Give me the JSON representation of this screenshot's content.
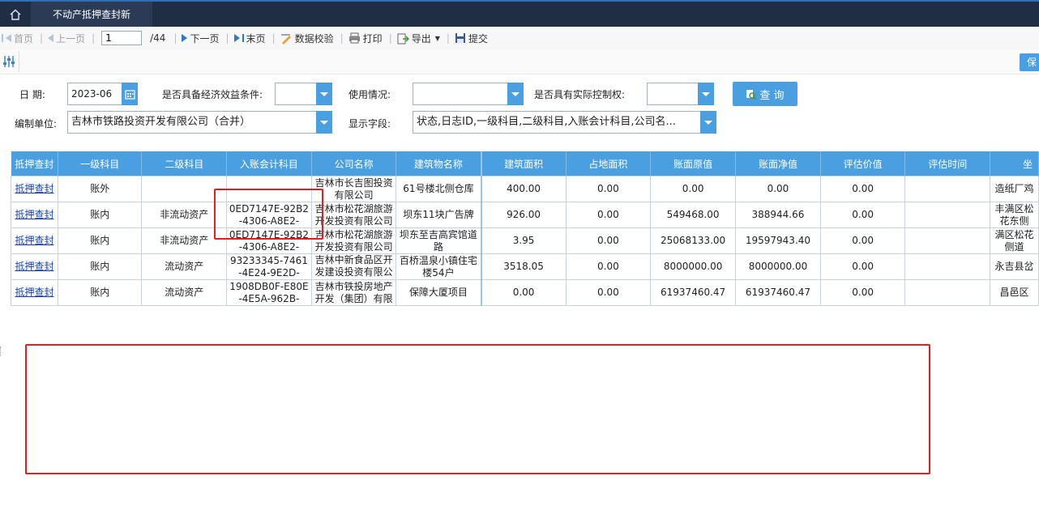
{
  "app": {
    "tab_title": "不动产抵押查封新"
  },
  "toolbar": {
    "first": "首页",
    "prev": "上一页",
    "page_value": "1",
    "page_total": "/44",
    "next": "下一页",
    "last": "末页",
    "validate": "数据校验",
    "print": "打印",
    "export": "导出",
    "submit": "提交"
  },
  "strip": {
    "save_label": "保"
  },
  "filters": {
    "date_label": "日  期:",
    "date_value": "2023-06",
    "econ_label": "是否具备经济效益条件:",
    "econ_value": "",
    "usage_label": "使用情况:",
    "usage_value": "",
    "control_label": "是否具有实际控制权:",
    "control_value": "",
    "query_label": "查 询",
    "unit_label": "编制单位:",
    "unit_value": "吉林市铁路投资开发有限公司（合并）",
    "fields_label": "显示字段:",
    "fields_value": "状态,日志ID,一级科目,二级科目,入账会计科目,公司名..."
  },
  "table": {
    "headers": [
      "抵押查封",
      "一级科目",
      "二级科目",
      "入账会计科目",
      "公司名称",
      "建筑物名称",
      "建筑面积",
      "占地面积",
      "账面原值",
      "账面净值",
      "评估价值",
      "评估时间",
      "坐"
    ],
    "rows": [
      {
        "action": "抵押查封",
        "level1": "账外",
        "level2": "",
        "account": "",
        "company": "吉林市长吉图投资有限公司",
        "building": "61号楼北侧仓库",
        "area": "400.00",
        "land": "0.00",
        "orig": "0.00",
        "net": "0.00",
        "eval": "0.00",
        "evaltime": "",
        "loc": "造纸厂鸡"
      },
      {
        "action": "抵押查封",
        "level1": "账内",
        "level2": "非流动资产",
        "account": "0ED7147E-92B2-4306-A8E2-",
        "company": "吉林市松花湖旅游开发投资有限公司",
        "building": "坝东11块广告牌",
        "area": "926.00",
        "land": "0.00",
        "orig": "549468.00",
        "net": "388944.66",
        "eval": "0.00",
        "evaltime": "",
        "loc": "丰满区松花东侧"
      },
      {
        "action": "抵押查封",
        "level1": "账内",
        "level2": "非流动资产",
        "account": "0ED7147E-92B2-4306-A8E2-",
        "company": "吉林市松花湖旅游开发投资有限公司",
        "building": "坝东至吉高宾馆道路",
        "area": "3.95",
        "land": "0.00",
        "orig": "25068133.00",
        "net": "19597943.40",
        "eval": "0.00",
        "evaltime": "",
        "loc": "满区松花侧道"
      },
      {
        "action": "抵押查封",
        "level1": "账内",
        "level2": "流动资产",
        "account": "93233345-7461-4E24-9E2D-",
        "company": "吉林中新食品区开发建设投资有限公司",
        "building": "百桥温泉小镇住宅楼54户",
        "area": "3518.05",
        "land": "0.00",
        "orig": "8000000.00",
        "net": "8000000.00",
        "eval": "0.00",
        "evaltime": "",
        "loc": "永吉县岔"
      },
      {
        "action": "抵押查封",
        "level1": "账内",
        "level2": "流动资产",
        "account": "1908DB0F-E80E-4E5A-962B-",
        "company": "吉林市铁投房地产开发（集团）有限",
        "building": "保障大厦项目",
        "area": "0.00",
        "land": "0.00",
        "orig": "61937460.47",
        "net": "61937460.47",
        "eval": "0.00",
        "evaltime": "",
        "loc": "昌邑区"
      }
    ]
  },
  "colors": {
    "accent": "#4a9fe0",
    "titlebar": "#1f2d45",
    "annotation": "#e02020",
    "link": "#1a43b5"
  }
}
